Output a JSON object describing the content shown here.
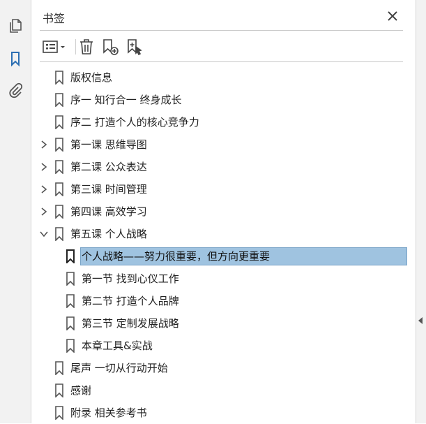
{
  "panel": {
    "title": "书签"
  },
  "rail": {
    "icons": [
      "pages-icon",
      "bookmarks-icon",
      "attachments-icon"
    ]
  },
  "colors": {
    "selected_bg": "#9fc3e0",
    "accent": "#2c6fb3"
  },
  "bookmarks": [
    {
      "label": "版权信息",
      "level": 0,
      "expander": "none"
    },
    {
      "label": "序一 知行合一 终身成长",
      "level": 0,
      "expander": "none"
    },
    {
      "label": "序二 打造个人的核心竞争力",
      "level": 0,
      "expander": "none"
    },
    {
      "label": "第一课 思维导图",
      "level": 0,
      "expander": "collapsed"
    },
    {
      "label": "第二课 公众表达",
      "level": 0,
      "expander": "collapsed"
    },
    {
      "label": "第三课 时间管理",
      "level": 0,
      "expander": "collapsed"
    },
    {
      "label": "第四课 高效学习",
      "level": 0,
      "expander": "collapsed"
    },
    {
      "label": "第五课 个人战略",
      "level": 0,
      "expander": "expanded"
    },
    {
      "label": "个人战略——努力很重要，但方向更重要",
      "level": 1,
      "expander": "none",
      "selected": true
    },
    {
      "label": "第一节 找到心仪工作",
      "level": 1,
      "expander": "none"
    },
    {
      "label": "第二节 打造个人品牌",
      "level": 1,
      "expander": "none"
    },
    {
      "label": "第三节 定制发展战略",
      "level": 1,
      "expander": "none"
    },
    {
      "label": "本章工具&实战",
      "level": 1,
      "expander": "none"
    },
    {
      "label": "尾声 一切从行动开始",
      "level": 0,
      "expander": "none"
    },
    {
      "label": "感谢",
      "level": 0,
      "expander": "none"
    },
    {
      "label": "附录 相关参考书",
      "level": 0,
      "expander": "none"
    }
  ]
}
